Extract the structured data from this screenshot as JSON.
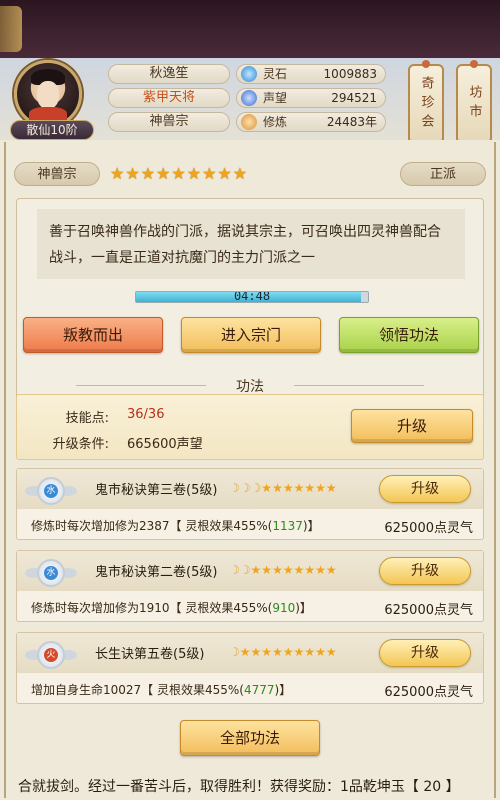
{
  "player": {
    "rank": "散仙10阶",
    "name": "秋逸笙",
    "title": "紫甲天将",
    "sect": "神兽宗"
  },
  "resources": [
    {
      "label": "灵石",
      "value": "1009883",
      "icon": "spirit-stone-icon",
      "color": "#4aa3e0"
    },
    {
      "label": "声望",
      "value": "294521",
      "icon": "reputation-icon",
      "color": "#5a8ad6"
    },
    {
      "label": "修炼",
      "value": "24483年",
      "icon": "cultivation-icon",
      "color": "#d9913a"
    }
  ],
  "side_buttons": {
    "treasure": "奇珍会",
    "market": "坊市"
  },
  "sect_panel": {
    "name": "神兽宗",
    "star_count": 9,
    "alignment": "正派",
    "description": "善于召唤神兽作战的门派，据说其宗主，可召唤出四灵神兽配合战斗，一直是正道对抗魔门的主力门派之一",
    "timer": "04:48",
    "timer_progress": 0.97,
    "buttons": {
      "betray": "叛教而出",
      "enter": "进入宗门",
      "comprehend": "领悟功法"
    }
  },
  "skills_section": {
    "title": "功法",
    "points_label": "技能点:",
    "points_value": "36/36",
    "cond_label": "升级条件:",
    "cond_value": "665600声望",
    "upgrade_label": "升级"
  },
  "skills": [
    {
      "element": "水",
      "element_color": "#3a8ad6",
      "name": "鬼市秘诀第三卷(5级)",
      "moons": 3,
      "stars": 7,
      "desc_pre": "修炼时每次增加修为2387【 灵根效果455%(",
      "desc_green": "1137",
      "desc_post": ")】",
      "cost": "625000点灵气",
      "upgrade_label": "升级"
    },
    {
      "element": "水",
      "element_color": "#3a8ad6",
      "name": "鬼市秘诀第二卷(5级)",
      "moons": 2,
      "stars": 8,
      "desc_pre": "修炼时每次增加修为1910【 灵根效果455%(",
      "desc_green": "910",
      "desc_post": ")】",
      "cost": "625000点灵气",
      "upgrade_label": "升级"
    },
    {
      "element": "火",
      "element_color": "#d44a2a",
      "name": "长生诀第五卷(5级)",
      "moons": 1,
      "stars": 9,
      "desc_pre": "增加自身生命10027【 灵根效果455%(",
      "desc_green": "4777",
      "desc_post": ")】",
      "cost": "625000点灵气",
      "upgrade_label": "升级"
    }
  ],
  "all_skills_button": "全部功法",
  "log": "合就拔剑。经过一番苦斗后，取得胜利！获得奖励：1品乾坤玉【 20 】"
}
